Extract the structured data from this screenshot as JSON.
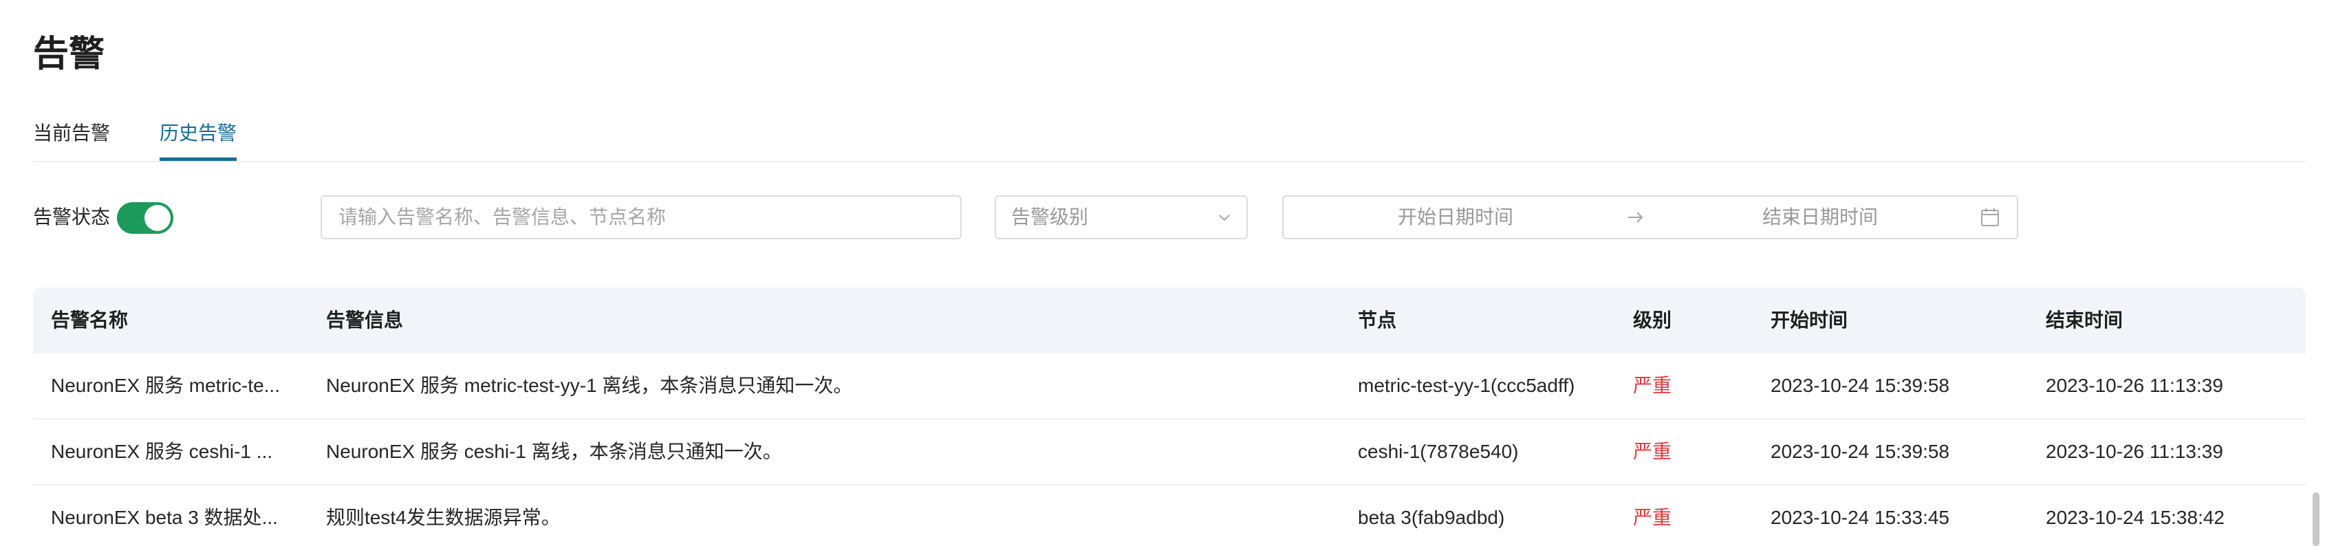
{
  "page": {
    "title": "告警"
  },
  "tabs": [
    {
      "label": "当前告警",
      "active": false
    },
    {
      "label": "历史告警",
      "active": true
    }
  ],
  "filters": {
    "status_label": "告警状态",
    "status_on": true,
    "search_placeholder": "请输入告警名称、告警信息、节点名称",
    "level_placeholder": "告警级别",
    "start_placeholder": "开始日期时间",
    "end_placeholder": "结束日期时间"
  },
  "table": {
    "columns": [
      "告警名称",
      "告警信息",
      "节点",
      "级别",
      "开始时间",
      "结束时间"
    ],
    "rows": [
      {
        "name": "NeuronEX 服务 metric-te...",
        "info": "NeuronEX 服务 metric-test-yy-1 离线，本条消息只通知一次。",
        "node": "metric-test-yy-1(ccc5adff)",
        "level": "严重",
        "start": "2023-10-24 15:39:58",
        "end": "2023-10-26 11:13:39"
      },
      {
        "name": "NeuronEX 服务 ceshi-1 ...",
        "info": "NeuronEX 服务 ceshi-1 离线，本条消息只通知一次。",
        "node": "ceshi-1(7878e540)",
        "level": "严重",
        "start": "2023-10-24 15:39:58",
        "end": "2023-10-26 11:13:39"
      },
      {
        "name": "NeuronEX beta 3 数据处...",
        "info": "规则test4发生数据源异常。",
        "node": "beta 3(fab9adbd)",
        "level": "严重",
        "start": "2023-10-24 15:33:45",
        "end": "2023-10-24 15:38:42"
      }
    ]
  },
  "colors": {
    "accent": "#146c94",
    "switch_on": "#1c9a5c",
    "danger": "#e5383b",
    "header_bg": "#f2f4f9"
  },
  "icons": {
    "select": "chevron-down-icon",
    "range_separator": "arrow-right-icon",
    "range": "calendar-icon"
  }
}
